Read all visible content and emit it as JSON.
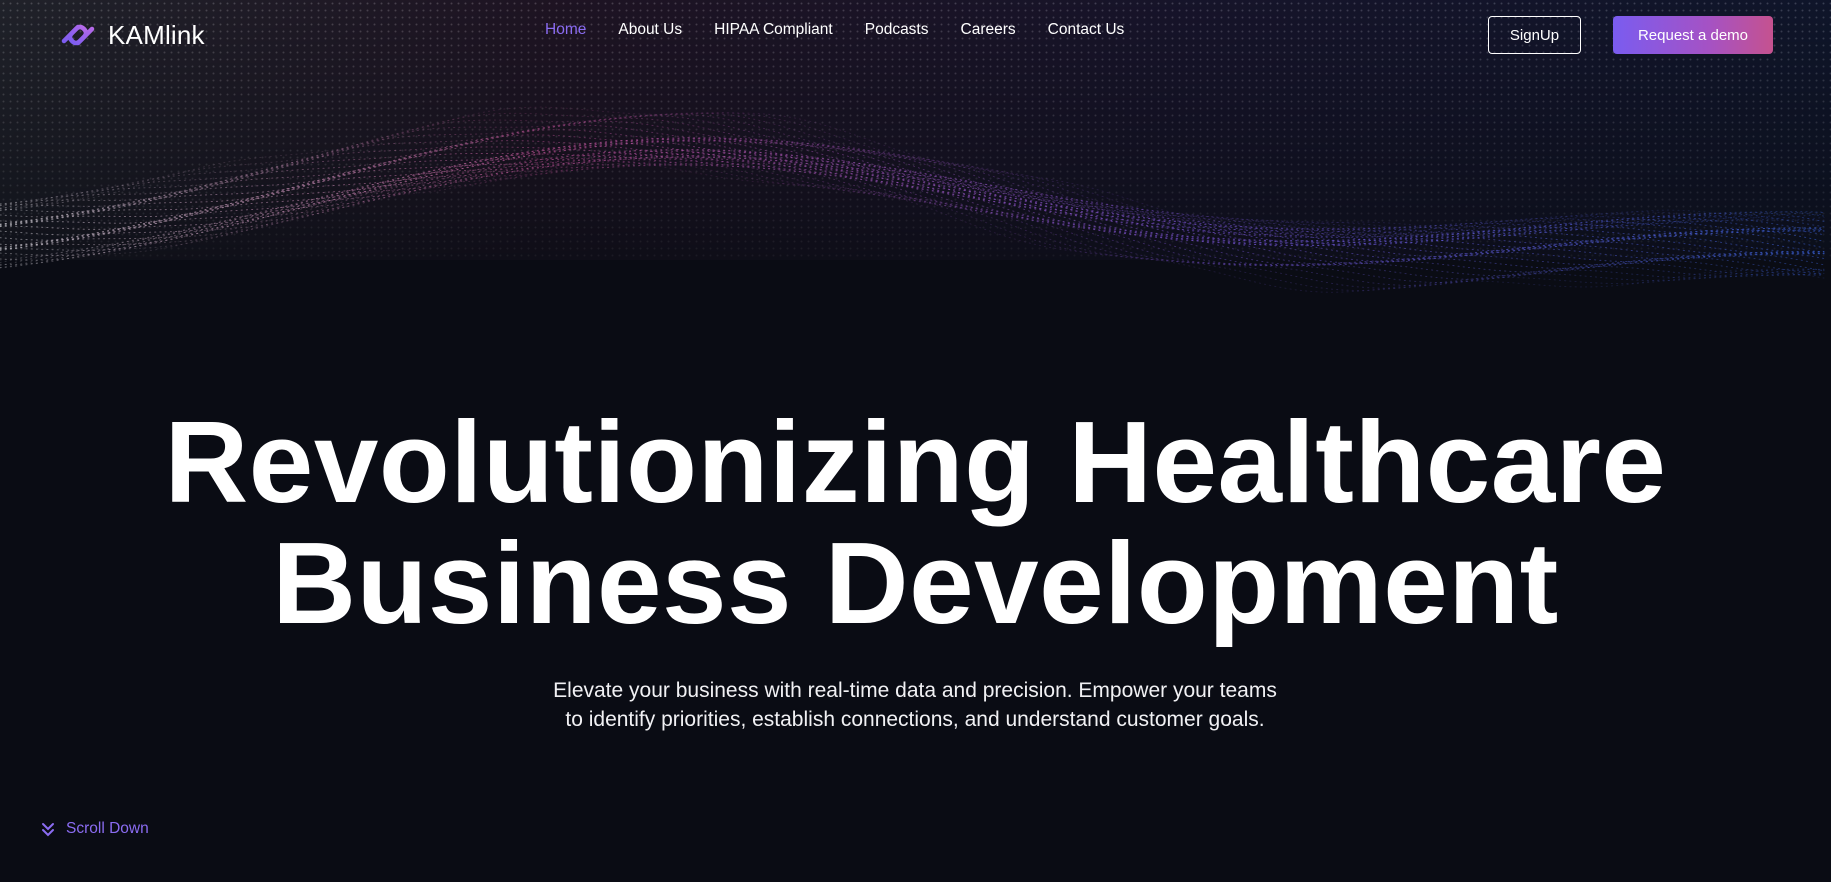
{
  "brand": {
    "name": "KAMlink",
    "logo_icon": "chain-link-icon",
    "accent_color": "#8b6cf2"
  },
  "nav": {
    "items": [
      {
        "label": "Home",
        "active": true
      },
      {
        "label": "About Us",
        "active": false
      },
      {
        "label": "HIPAA Compliant",
        "active": false
      },
      {
        "label": "Podcasts",
        "active": false
      },
      {
        "label": "Careers",
        "active": false
      },
      {
        "label": "Contact Us",
        "active": false
      }
    ]
  },
  "header": {
    "signup_label": "SignUp",
    "demo_label": "Request a demo"
  },
  "hero": {
    "title_line1": "Revolutionizing Healthcare",
    "title_line2": "Business Development",
    "subtitle_line1": "Elevate your business with real-time data and precision. Empower your teams",
    "subtitle_line2": "to identify priorities, establish connections, and understand customer goals."
  },
  "scroll": {
    "label": "Scroll Down",
    "icon": "double-chevron-down-icon"
  },
  "colors": {
    "background": "#0a0c14",
    "wave_pink": "#d65aa8",
    "wave_purple": "#8a5cf0",
    "wave_blue": "#3f6cf2",
    "wave_white": "#e8e8ee"
  }
}
